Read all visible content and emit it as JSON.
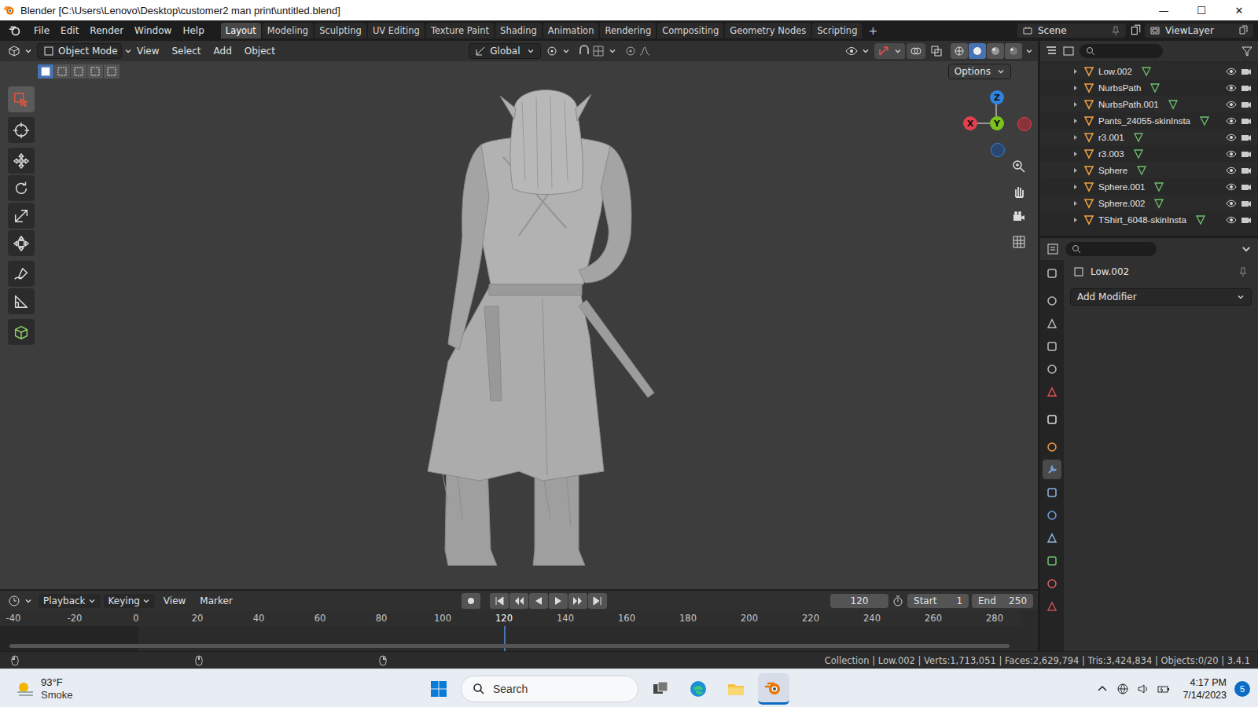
{
  "window": {
    "title": "Blender [C:\\Users\\Lenovo\\Desktop\\customer2 man print\\untitled.blend]",
    "controls": [
      "—",
      "☐",
      "✕"
    ]
  },
  "menu": [
    "File",
    "Edit",
    "Render",
    "Window",
    "Help"
  ],
  "workspaces": [
    {
      "label": "Layout",
      "selected": true
    },
    {
      "label": "Modeling",
      "selected": false
    },
    {
      "label": "Sculpting",
      "selected": false
    },
    {
      "label": "UV Editing",
      "selected": false
    },
    {
      "label": "Texture Paint",
      "selected": false
    },
    {
      "label": "Shading",
      "selected": false
    },
    {
      "label": "Animation",
      "selected": false
    },
    {
      "label": "Rendering",
      "selected": false
    },
    {
      "label": "Compositing",
      "selected": false
    },
    {
      "label": "Geometry Nodes",
      "selected": false
    },
    {
      "label": "Scripting",
      "selected": false
    }
  ],
  "add_workspace": "+",
  "scene": "Scene",
  "view_layer": "ViewLayer",
  "viewport": {
    "mode": "Object Mode",
    "menus": [
      "View",
      "Select",
      "Add",
      "Object"
    ],
    "orientation": "Global",
    "options": "Options",
    "select_modes": [
      {
        "selected": true
      },
      {
        "selected": false
      },
      {
        "selected": false
      },
      {
        "selected": false
      },
      {
        "selected": false
      }
    ],
    "shading": [
      {
        "selected": false
      },
      {
        "selected": true
      },
      {
        "selected": false
      },
      {
        "selected": false
      }
    ],
    "tools": [
      {
        "selected": true
      },
      {
        "selected": false
      },
      {
        "selected": false
      },
      {
        "selected": false
      },
      {
        "selected": false
      },
      {
        "selected": false
      },
      {
        "selected": false
      },
      {
        "selected": false
      },
      {
        "selected": false
      }
    ],
    "gizmo": {
      "x": "X",
      "y": "Y",
      "z": "Z"
    }
  },
  "outliner": {
    "items": [
      {
        "name": "Low.002",
        "visible": true
      },
      {
        "name": "NurbsPath",
        "visible": true
      },
      {
        "name": "NurbsPath.001",
        "visible": true
      },
      {
        "name": "Pants_24055-skinInsta",
        "visible": true
      },
      {
        "name": "r3.001",
        "visible": true
      },
      {
        "name": "r3.003",
        "visible": true
      },
      {
        "name": "Sphere",
        "visible": true
      },
      {
        "name": "Sphere.001",
        "visible": true
      },
      {
        "name": "Sphere.002",
        "visible": true
      },
      {
        "name": "TShirt_6048-skinInsta",
        "visible": true
      }
    ]
  },
  "properties": {
    "object": "Low.002",
    "add_modifier": "Add Modifier",
    "tabs": [
      {
        "selected": false
      },
      {
        "selected": false
      },
      {
        "selected": false
      },
      {
        "selected": false
      },
      {
        "selected": false
      },
      {
        "selected": false
      },
      {
        "selected": false
      },
      {
        "selected": false
      },
      {
        "selected": true
      },
      {
        "selected": false
      },
      {
        "selected": false
      },
      {
        "selected": false
      },
      {
        "selected": false
      },
      {
        "selected": false
      },
      {
        "selected": false
      }
    ]
  },
  "timeline": {
    "menus": [
      "Playback",
      "Keying",
      "View",
      "Marker"
    ],
    "current_frame": "120",
    "start_label": "Start",
    "start": "1",
    "end_label": "End",
    "end": "250",
    "ruler": [
      "-40",
      "-20",
      "0",
      "20",
      "40",
      "60",
      "80",
      "100",
      "120",
      "140",
      "160",
      "180",
      "200",
      "220",
      "240",
      "260",
      "280"
    ]
  },
  "status_bar": {
    "text": "Collection | Low.002 | Verts:1,713,051 | Faces:2,629,794 | Tris:3,424,834 | Objects:0/20 | 3.4.1"
  },
  "taskbar": {
    "temperature": "93°F",
    "condition": "Smoke",
    "search": "Search",
    "time": "4:17 PM",
    "date": "7/14/2023",
    "notifications": "5"
  }
}
